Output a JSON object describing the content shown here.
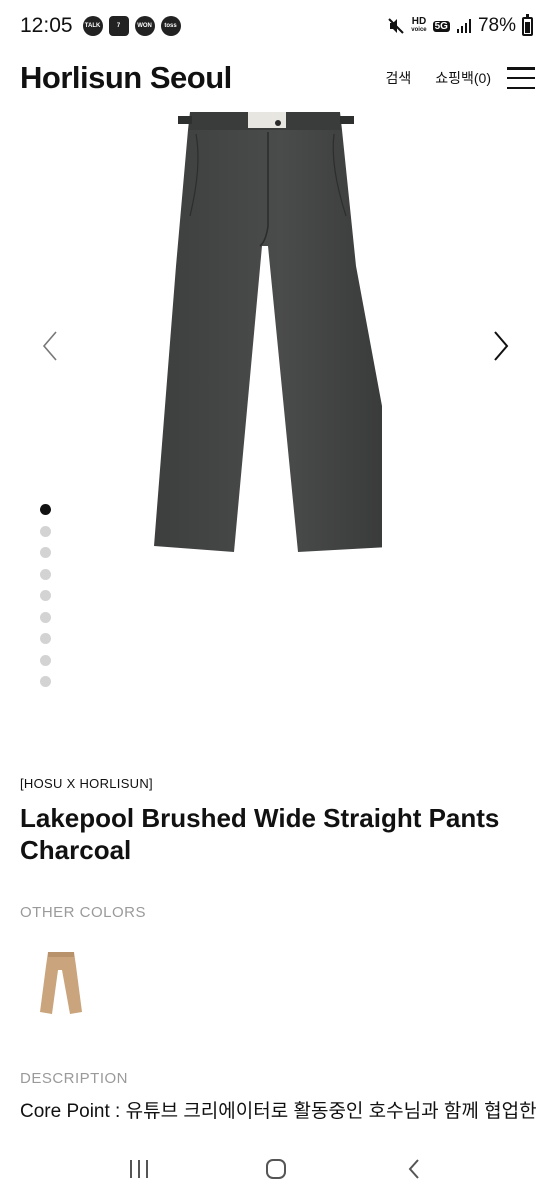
{
  "status_bar": {
    "time": "12:05",
    "notifications": [
      "TALK",
      "7",
      "WON",
      "toss"
    ],
    "hd_top": "HD",
    "hd_bottom": "voice",
    "network": "5G",
    "battery": "78%"
  },
  "header": {
    "brand": "Horlisun Seoul",
    "search_label": "검색",
    "bag_label": "쇼핑백(0)"
  },
  "gallery": {
    "slide_count": 9,
    "active_slide": 1
  },
  "product": {
    "collab": "[HOSU X HORLISUN]",
    "title": "Lakepool Brushed Wide Straight Pants Charcoal",
    "other_colors_label": "OTHER COLORS",
    "description_label": "DESCRIPTION",
    "description_text": "Core Point : 유튜브 크리에이터로 활동중인 호수님과 함께 협업한"
  },
  "colors": {
    "charcoal": "#3a3b3b",
    "beige": "#c9a47c",
    "muted_label": "#9a9a9a"
  }
}
